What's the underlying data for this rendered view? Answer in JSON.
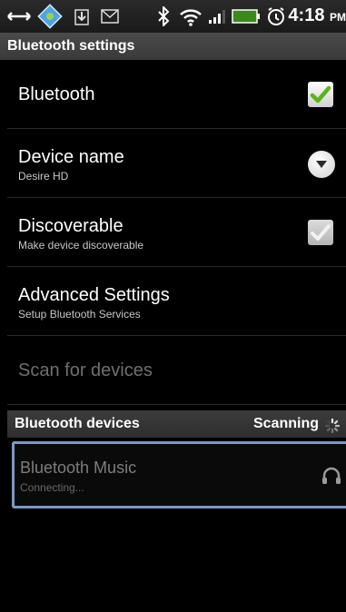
{
  "status_bar": {
    "icons": [
      "usb-icon",
      "sync-icon",
      "download-icon",
      "mail-icon",
      "bluetooth-icon",
      "wifi-icon",
      "signal-icon",
      "battery-icon",
      "alarm-icon"
    ],
    "battery_level": "77",
    "time": "4:18",
    "ampm": "PM"
  },
  "header": {
    "title": "Bluetooth settings"
  },
  "settings": [
    {
      "title": "Bluetooth",
      "subtitle": "",
      "control": "checkbox",
      "checked": true,
      "enabled": true
    },
    {
      "title": "Device name",
      "subtitle": "Desire HD",
      "control": "dropdown"
    },
    {
      "title": "Discoverable",
      "subtitle": "Make device discoverable",
      "control": "checkbox",
      "checked": true,
      "enabled": false
    },
    {
      "title": "Advanced Settings",
      "subtitle": "Setup Bluetooth Services",
      "control": "none"
    },
    {
      "title": "Scan for devices",
      "subtitle": "",
      "control": "none",
      "enabled": false
    }
  ],
  "devices_section": {
    "title": "Bluetooth devices",
    "status": "Scanning"
  },
  "devices": [
    {
      "name": "Bluetooth Music",
      "status": "Connecting...",
      "icon": "headphones-icon"
    }
  ],
  "colors": {
    "check_green": "#5cb31c",
    "focus_border": "#7a9ac2"
  }
}
